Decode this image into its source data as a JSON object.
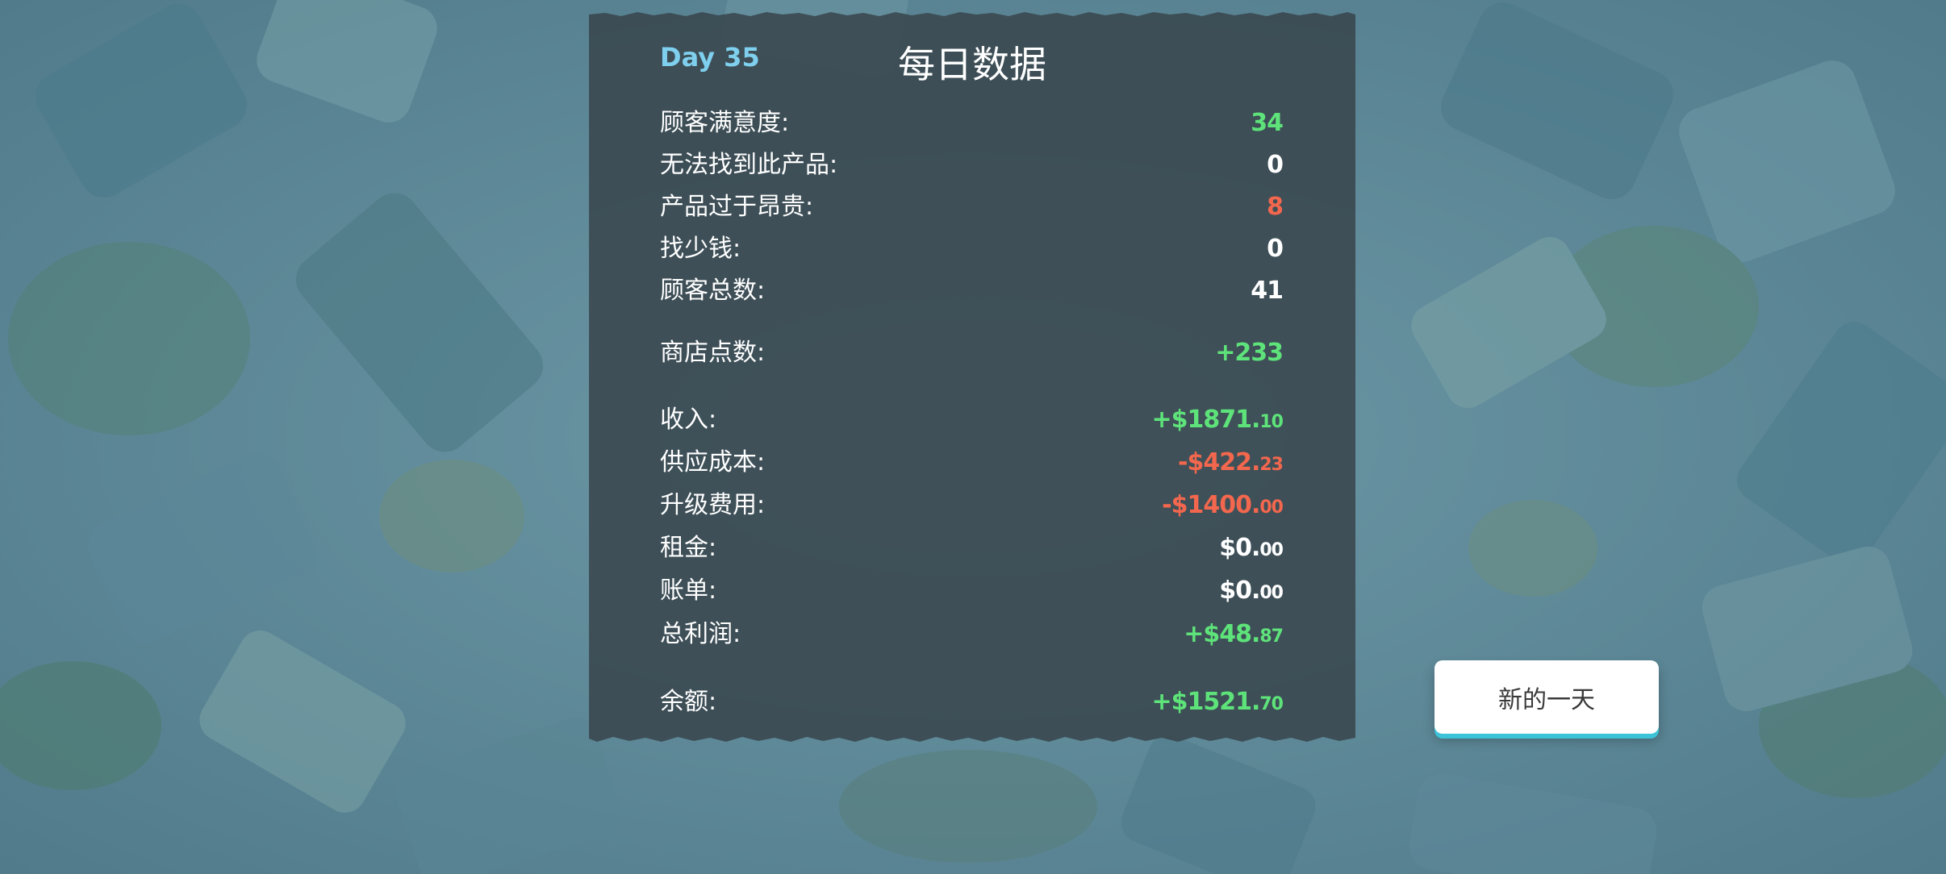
{
  "colors": {
    "background": "#5b8594",
    "panel": "#38454c",
    "positive": "#5ee37a",
    "negative": "#f2674d",
    "neutral": "#ffffff",
    "day_label": "#7fd0ee",
    "button_accent": "#3cc3d8"
  },
  "report": {
    "day": "Day 35",
    "title": "每日数据",
    "rows": [
      {
        "label": "顾客满意度:",
        "value": "34",
        "cents": "",
        "tone": "green"
      },
      {
        "label": "无法找到此产品:",
        "value": "0",
        "cents": "",
        "tone": "white"
      },
      {
        "label": "产品过于昂贵:",
        "value": "8",
        "cents": "",
        "tone": "red"
      },
      {
        "label": "找少钱:",
        "value": "0",
        "cents": "",
        "tone": "white"
      },
      {
        "label": "顾客总数:",
        "value": "41",
        "cents": "",
        "tone": "white"
      },
      {
        "label": "商店点数:",
        "value": "+233",
        "cents": "",
        "tone": "green"
      },
      {
        "label": "收入:",
        "value": "+$1871.",
        "cents": "10",
        "tone": "green"
      },
      {
        "label": "供应成本:",
        "value": "-$422.",
        "cents": "23",
        "tone": "red"
      },
      {
        "label": "升级费用:",
        "value": "-$1400.",
        "cents": "00",
        "tone": "red"
      },
      {
        "label": "租金:",
        "value": "$0.",
        "cents": "00",
        "tone": "white"
      },
      {
        "label": "账单:",
        "value": "$0.",
        "cents": "00",
        "tone": "white"
      },
      {
        "label": "总利润:",
        "value": "+$48.",
        "cents": "87",
        "tone": "green"
      },
      {
        "label": "余额:",
        "value": "+$1521.",
        "cents": "70",
        "tone": "green"
      }
    ]
  },
  "actions": {
    "new_day_label": "新的一天"
  }
}
